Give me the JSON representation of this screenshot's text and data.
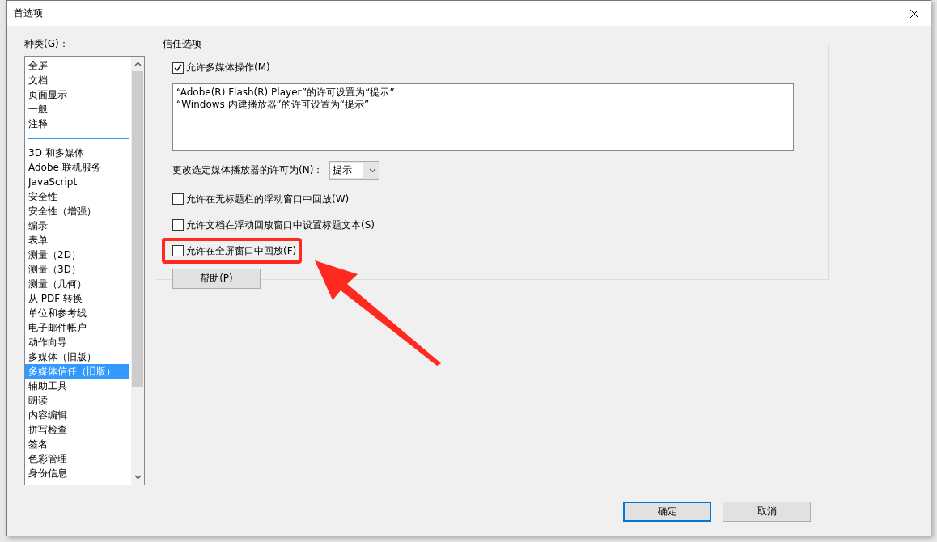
{
  "window": {
    "title": "首选项"
  },
  "categories": {
    "label": "种类(G)：",
    "items": [
      {
        "label": "全屏",
        "selected": false,
        "kind": "item"
      },
      {
        "label": "文档",
        "selected": false,
        "kind": "item"
      },
      {
        "label": "页面显示",
        "selected": false,
        "kind": "item"
      },
      {
        "label": "一般",
        "selected": false,
        "kind": "item"
      },
      {
        "label": "注释",
        "selected": false,
        "kind": "item"
      },
      {
        "kind": "separator"
      },
      {
        "label": "3D 和多媒体",
        "selected": false,
        "kind": "item"
      },
      {
        "label": "Adobe 联机服务",
        "selected": false,
        "kind": "item"
      },
      {
        "label": "JavaScript",
        "selected": false,
        "kind": "item"
      },
      {
        "label": "安全性",
        "selected": false,
        "kind": "item"
      },
      {
        "label": "安全性（增强）",
        "selected": false,
        "kind": "item"
      },
      {
        "label": "编录",
        "selected": false,
        "kind": "item"
      },
      {
        "label": "表单",
        "selected": false,
        "kind": "item"
      },
      {
        "label": "测量（2D）",
        "selected": false,
        "kind": "item"
      },
      {
        "label": "测量（3D）",
        "selected": false,
        "kind": "item"
      },
      {
        "label": "测量（几何）",
        "selected": false,
        "kind": "item"
      },
      {
        "label": "从 PDF 转换",
        "selected": false,
        "kind": "item"
      },
      {
        "label": "单位和参考线",
        "selected": false,
        "kind": "item"
      },
      {
        "label": "电子邮件帐户",
        "selected": false,
        "kind": "item"
      },
      {
        "label": "动作向导",
        "selected": false,
        "kind": "item"
      },
      {
        "label": "多媒体（旧版）",
        "selected": false,
        "kind": "item"
      },
      {
        "label": "多媒体信任（旧版）",
        "selected": true,
        "kind": "item"
      },
      {
        "label": "辅助工具",
        "selected": false,
        "kind": "item"
      },
      {
        "label": "朗读",
        "selected": false,
        "kind": "item"
      },
      {
        "label": "内容编辑",
        "selected": false,
        "kind": "item"
      },
      {
        "label": "拼写检查",
        "selected": false,
        "kind": "item"
      },
      {
        "label": "签名",
        "selected": false,
        "kind": "item"
      },
      {
        "label": "色彩管理",
        "selected": false,
        "kind": "item"
      },
      {
        "label": "身份信息",
        "selected": false,
        "kind": "item"
      }
    ]
  },
  "trust_options": {
    "title": "信任选项",
    "allow_multimedia": {
      "label": "允许多媒体操作(M)",
      "checked": true
    },
    "permissions": [
      "“Adobe(R) Flash(R) Player”的许可设置为“提示”",
      "“Windows 内建播放器”的许可设置为“提示”"
    ],
    "change_permission": {
      "label": "更改选定媒体播放器的许可为(N)：",
      "value": "提示"
    },
    "options": [
      {
        "label": "允许在无标题栏的浮动窗口中回放(W)",
        "checked": false,
        "highlighted": false
      },
      {
        "label": "允许文档在浮动回放窗口中设置标题文本(S)",
        "checked": false,
        "highlighted": false
      },
      {
        "label": "允许在全屏窗口中回放(F)",
        "checked": false,
        "highlighted": true
      }
    ],
    "help_button": "帮助(P)"
  },
  "buttons": [
    {
      "label": "确定",
      "selected": true
    },
    {
      "label": "取消",
      "selected": false
    }
  ]
}
